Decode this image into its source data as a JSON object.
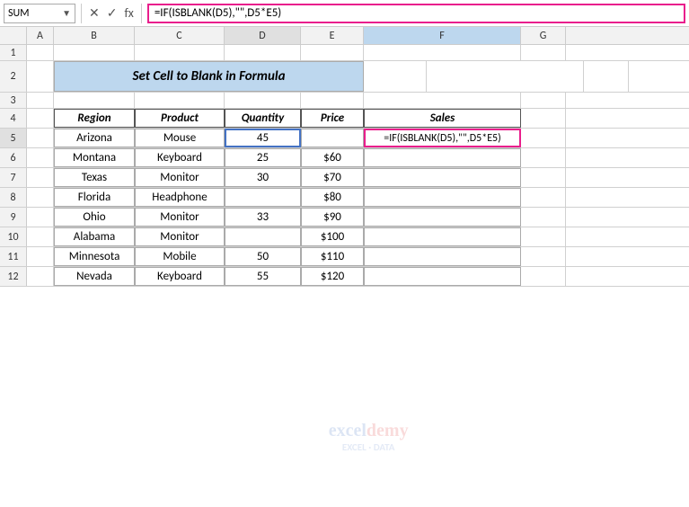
{
  "formulaBar": {
    "nameBox": "SUM",
    "cancelIcon": "✕",
    "confirmIcon": "✓",
    "fxLabel": "fx",
    "formula": "=IF(ISBLANK(D5),\"\",D5*E5)"
  },
  "title": "Set Cell to Blank in Formula",
  "columns": [
    "A",
    "B",
    "C",
    "D",
    "E",
    "F",
    "G"
  ],
  "headers": {
    "region": "Region",
    "product": "Product",
    "quantity": "Quantity",
    "price": "Price",
    "sales": "Sales"
  },
  "rows": [
    {
      "region": "Arizona",
      "product": "Mouse",
      "quantity": "45",
      "price": "",
      "sales": "=IF(ISBLANK(D5),\"\",D5*E5)"
    },
    {
      "region": "Montana",
      "product": "Keyboard",
      "quantity": "25",
      "price": "$60",
      "sales": ""
    },
    {
      "region": "Texas",
      "product": "Monitor",
      "quantity": "30",
      "price": "$70",
      "sales": ""
    },
    {
      "region": "Florida",
      "product": "Headphone",
      "quantity": "",
      "price": "$80",
      "sales": ""
    },
    {
      "region": "Ohio",
      "product": "Monitor",
      "quantity": "33",
      "price": "$90",
      "sales": ""
    },
    {
      "region": "Alabama",
      "product": "Monitor",
      "quantity": "",
      "price": "$100",
      "sales": ""
    },
    {
      "region": "Minnesota",
      "product": "Mobile",
      "quantity": "50",
      "price": "$110",
      "sales": ""
    },
    {
      "region": "Nevada",
      "product": "Keyboard",
      "quantity": "55",
      "price": "$120",
      "sales": ""
    }
  ],
  "watermark": "excel"
}
